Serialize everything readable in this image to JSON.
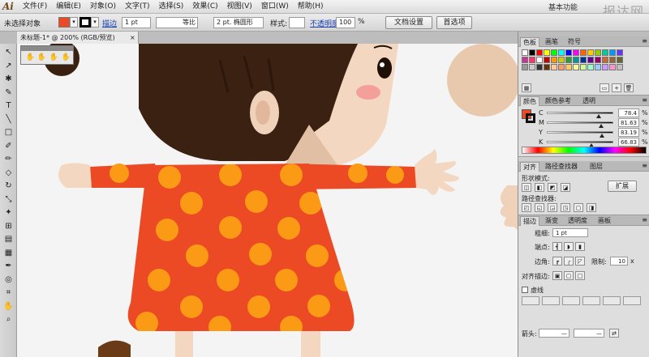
{
  "app": {
    "logo": "Ai",
    "menu": [
      "文件(F)",
      "编辑(E)",
      "对象(O)",
      "文字(T)",
      "选择(S)",
      "效果(C)",
      "视图(V)",
      "窗口(W)",
      "帮助(H)"
    ],
    "workspace": "基本功能",
    "brand": "报达网"
  },
  "control_bar": {
    "selection_status": "未选择对象",
    "fill_color": "#ec4a25",
    "stroke_label": "描边",
    "stroke_weight": "1 pt",
    "stroke_profile": "等比",
    "brush": "2 pt. 椭圆形",
    "style_label": "样式:",
    "opacity_label": "不透明度",
    "opacity_value": "100",
    "opacity_unit": "%",
    "doc_setup_button": "文档设置",
    "preferences_button": "首选项"
  },
  "document": {
    "tab_title": "未标题-1* @ 200% (RGB/预览)",
    "close_glyph": "×"
  },
  "toolbox": {
    "tools": [
      "↖",
      "↗",
      "✱",
      "✎",
      "T",
      "╲",
      "□",
      "✐",
      "✏",
      "◇",
      "↻",
      "⤡",
      "✦",
      "⊞",
      "▤",
      "▦",
      "✒",
      "◎",
      "⌗",
      "✋",
      "⌕"
    ]
  },
  "panels": {
    "swatch_panel": {
      "tabs": [
        "色板",
        "画笔",
        "符号"
      ],
      "swatches": [
        "#ffffff",
        "#000000",
        "#ff0000",
        "#ffff00",
        "#00ff00",
        "#00ffff",
        "#0000ff",
        "#ff00ff",
        "#ff6600",
        "#ffcc00",
        "#99cc00",
        "#00cc99",
        "#0099ff",
        "#6633ff",
        "#cc3399",
        "#ff3366",
        "#ffffff",
        "#cc0000",
        "#ff9900",
        "#cccc00",
        "#339933",
        "#009999",
        "#003399",
        "#660099",
        "#990066",
        "#cc6633",
        "#996633",
        "#666633",
        "#999999",
        "#cccccc",
        "#333333",
        "#663300",
        "#ffcc99",
        "#ff9966",
        "#ffcc66",
        "#ffff99",
        "#ccff99",
        "#99ffcc",
        "#99ccff",
        "#cc99ff",
        "#ff99cc",
        "#c0c0c0"
      ]
    },
    "color_panel": {
      "tabs": [
        "颜色",
        "颜色参考",
        "透明"
      ],
      "channels": [
        {
          "name": "C",
          "value": "78.4",
          "fraction": 0.78
        },
        {
          "name": "M",
          "value": "81.63",
          "fraction": 0.82
        },
        {
          "name": "Y",
          "value": "83.19",
          "fraction": 0.83
        },
        {
          "name": "K",
          "value": "66.83",
          "fraction": 0.67
        }
      ],
      "unit": "%",
      "fill_color": "#ec4a25"
    },
    "pathfinder_panel": {
      "tabs": [
        "对齐",
        "路径查找器",
        "图层"
      ],
      "shape_modes_label": "形状模式:",
      "expand_button": "扩展",
      "pathfinder_label": "路径查找器:"
    },
    "stroke_panel": {
      "tabs": [
        "描边",
        "渐变",
        "透明度",
        "画板"
      ],
      "weight_label": "粗细:",
      "weight_value": "1 pt",
      "cap_label": "端点:",
      "corner_label": "边角:",
      "limit_label": "限制:",
      "limit_value": "10",
      "limit_unit": "x",
      "align_label": "对齐描边:",
      "dashed_label": "虚线",
      "arrows_label": "箭头:"
    }
  }
}
